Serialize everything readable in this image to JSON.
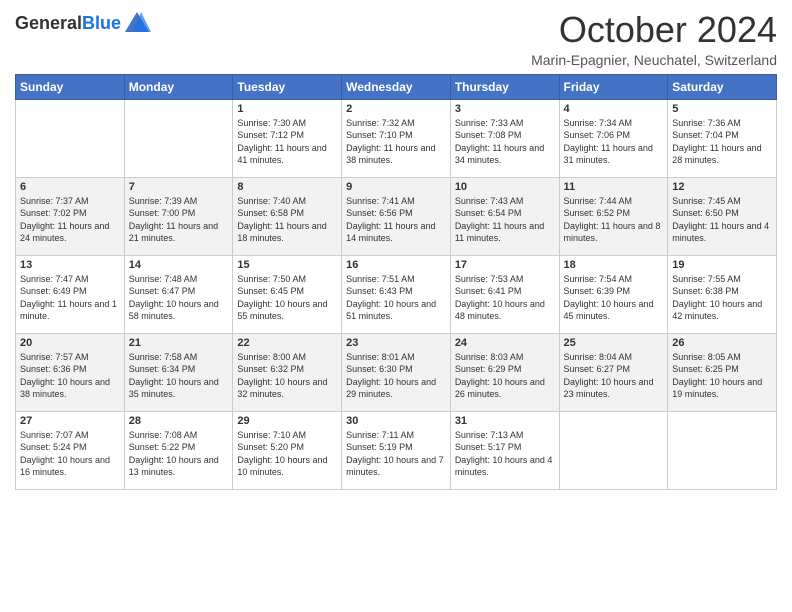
{
  "header": {
    "logo_general": "General",
    "logo_blue": "Blue",
    "month_title": "October 2024",
    "location": "Marin-Epagnier, Neuchatel, Switzerland"
  },
  "days_of_week": [
    "Sunday",
    "Monday",
    "Tuesday",
    "Wednesday",
    "Thursday",
    "Friday",
    "Saturday"
  ],
  "weeks": [
    [
      {
        "day": "",
        "content": ""
      },
      {
        "day": "",
        "content": ""
      },
      {
        "day": "1",
        "content": "Sunrise: 7:30 AM\nSunset: 7:12 PM\nDaylight: 11 hours and 41 minutes."
      },
      {
        "day": "2",
        "content": "Sunrise: 7:32 AM\nSunset: 7:10 PM\nDaylight: 11 hours and 38 minutes."
      },
      {
        "day": "3",
        "content": "Sunrise: 7:33 AM\nSunset: 7:08 PM\nDaylight: 11 hours and 34 minutes."
      },
      {
        "day": "4",
        "content": "Sunrise: 7:34 AM\nSunset: 7:06 PM\nDaylight: 11 hours and 31 minutes."
      },
      {
        "day": "5",
        "content": "Sunrise: 7:36 AM\nSunset: 7:04 PM\nDaylight: 11 hours and 28 minutes."
      }
    ],
    [
      {
        "day": "6",
        "content": "Sunrise: 7:37 AM\nSunset: 7:02 PM\nDaylight: 11 hours and 24 minutes."
      },
      {
        "day": "7",
        "content": "Sunrise: 7:39 AM\nSunset: 7:00 PM\nDaylight: 11 hours and 21 minutes."
      },
      {
        "day": "8",
        "content": "Sunrise: 7:40 AM\nSunset: 6:58 PM\nDaylight: 11 hours and 18 minutes."
      },
      {
        "day": "9",
        "content": "Sunrise: 7:41 AM\nSunset: 6:56 PM\nDaylight: 11 hours and 14 minutes."
      },
      {
        "day": "10",
        "content": "Sunrise: 7:43 AM\nSunset: 6:54 PM\nDaylight: 11 hours and 11 minutes."
      },
      {
        "day": "11",
        "content": "Sunrise: 7:44 AM\nSunset: 6:52 PM\nDaylight: 11 hours and 8 minutes."
      },
      {
        "day": "12",
        "content": "Sunrise: 7:45 AM\nSunset: 6:50 PM\nDaylight: 11 hours and 4 minutes."
      }
    ],
    [
      {
        "day": "13",
        "content": "Sunrise: 7:47 AM\nSunset: 6:49 PM\nDaylight: 11 hours and 1 minute."
      },
      {
        "day": "14",
        "content": "Sunrise: 7:48 AM\nSunset: 6:47 PM\nDaylight: 10 hours and 58 minutes."
      },
      {
        "day": "15",
        "content": "Sunrise: 7:50 AM\nSunset: 6:45 PM\nDaylight: 10 hours and 55 minutes."
      },
      {
        "day": "16",
        "content": "Sunrise: 7:51 AM\nSunset: 6:43 PM\nDaylight: 10 hours and 51 minutes."
      },
      {
        "day": "17",
        "content": "Sunrise: 7:53 AM\nSunset: 6:41 PM\nDaylight: 10 hours and 48 minutes."
      },
      {
        "day": "18",
        "content": "Sunrise: 7:54 AM\nSunset: 6:39 PM\nDaylight: 10 hours and 45 minutes."
      },
      {
        "day": "19",
        "content": "Sunrise: 7:55 AM\nSunset: 6:38 PM\nDaylight: 10 hours and 42 minutes."
      }
    ],
    [
      {
        "day": "20",
        "content": "Sunrise: 7:57 AM\nSunset: 6:36 PM\nDaylight: 10 hours and 38 minutes."
      },
      {
        "day": "21",
        "content": "Sunrise: 7:58 AM\nSunset: 6:34 PM\nDaylight: 10 hours and 35 minutes."
      },
      {
        "day": "22",
        "content": "Sunrise: 8:00 AM\nSunset: 6:32 PM\nDaylight: 10 hours and 32 minutes."
      },
      {
        "day": "23",
        "content": "Sunrise: 8:01 AM\nSunset: 6:30 PM\nDaylight: 10 hours and 29 minutes."
      },
      {
        "day": "24",
        "content": "Sunrise: 8:03 AM\nSunset: 6:29 PM\nDaylight: 10 hours and 26 minutes."
      },
      {
        "day": "25",
        "content": "Sunrise: 8:04 AM\nSunset: 6:27 PM\nDaylight: 10 hours and 23 minutes."
      },
      {
        "day": "26",
        "content": "Sunrise: 8:05 AM\nSunset: 6:25 PM\nDaylight: 10 hours and 19 minutes."
      }
    ],
    [
      {
        "day": "27",
        "content": "Sunrise: 7:07 AM\nSunset: 5:24 PM\nDaylight: 10 hours and 16 minutes."
      },
      {
        "day": "28",
        "content": "Sunrise: 7:08 AM\nSunset: 5:22 PM\nDaylight: 10 hours and 13 minutes."
      },
      {
        "day": "29",
        "content": "Sunrise: 7:10 AM\nSunset: 5:20 PM\nDaylight: 10 hours and 10 minutes."
      },
      {
        "day": "30",
        "content": "Sunrise: 7:11 AM\nSunset: 5:19 PM\nDaylight: 10 hours and 7 minutes."
      },
      {
        "day": "31",
        "content": "Sunrise: 7:13 AM\nSunset: 5:17 PM\nDaylight: 10 hours and 4 minutes."
      },
      {
        "day": "",
        "content": ""
      },
      {
        "day": "",
        "content": ""
      }
    ]
  ]
}
